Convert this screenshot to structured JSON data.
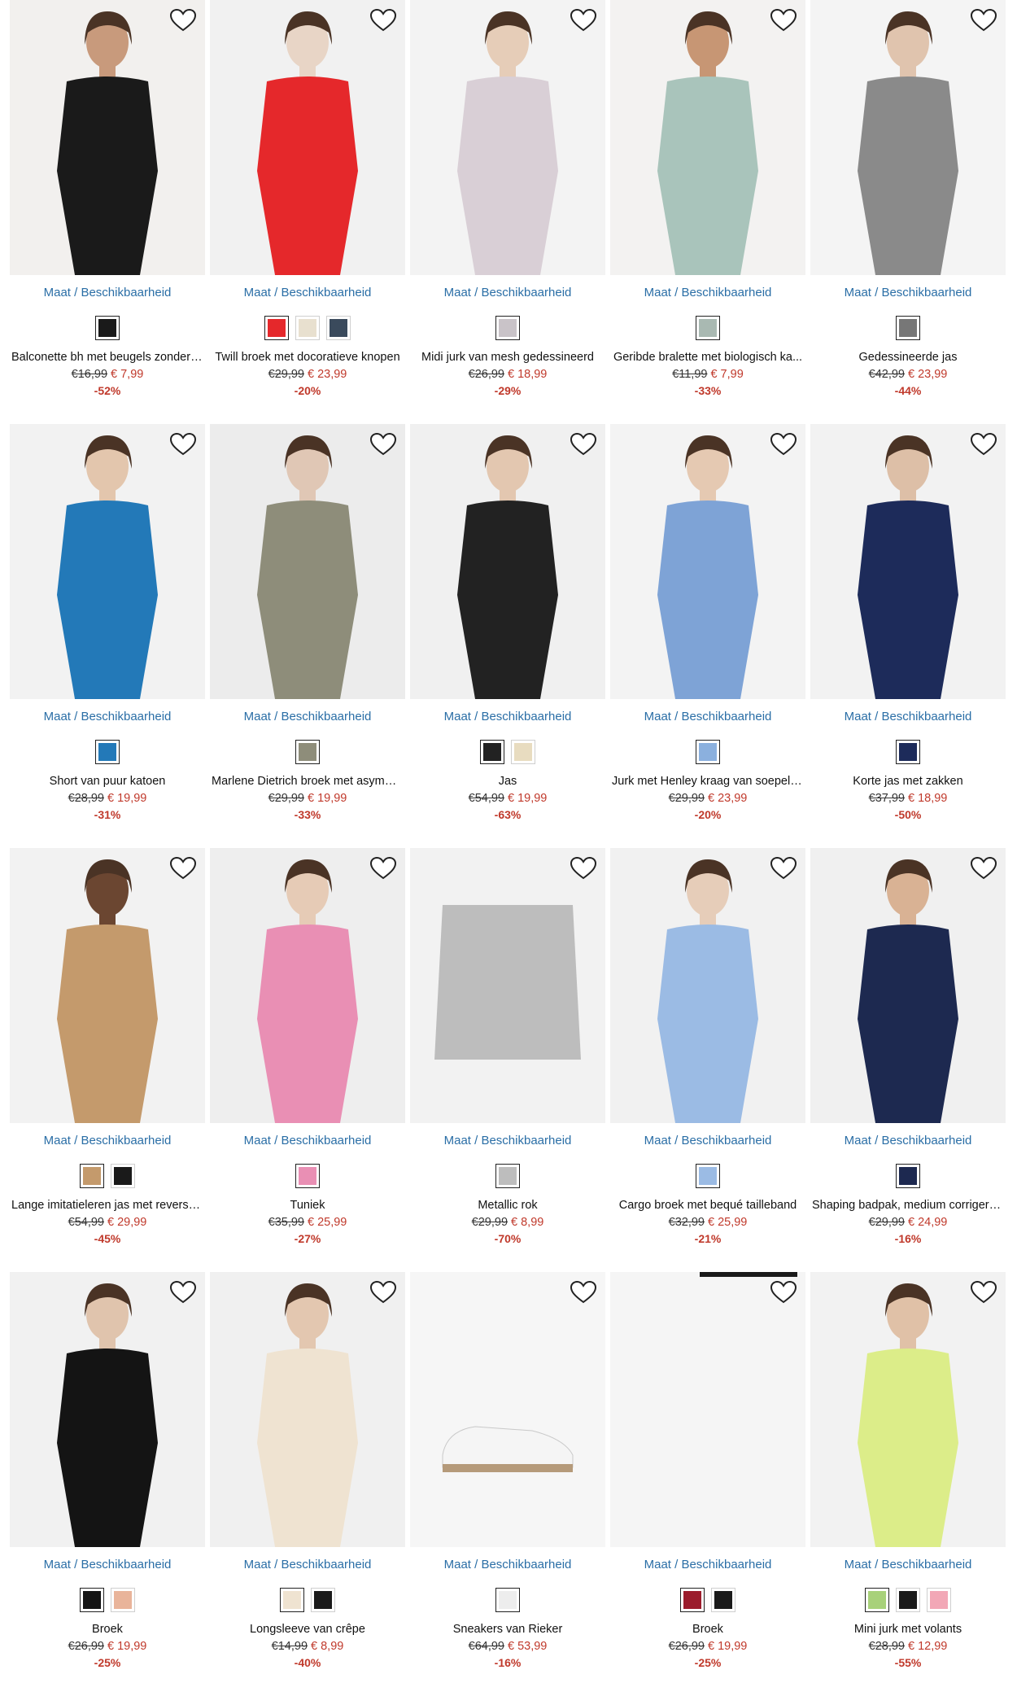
{
  "size_link": "Maat / Beschikbaarheid",
  "products": [
    {
      "title": "Balconette bh met beugels zonder ...",
      "old_price": "€16,99",
      "new_price": "€ 7,99",
      "discount": "-52%",
      "bg": "#f2f0ee",
      "garment": "#1a1a1a",
      "skin": "#c89a7c",
      "swatches": [
        "#1a1a1a"
      ]
    },
    {
      "title": "Twill broek met docoratieve knopen",
      "old_price": "€29,99",
      "new_price": "€ 23,99",
      "discount": "-20%",
      "bg": "#f1f1f1",
      "garment": "#e5282b",
      "skin": "#e8d5c6",
      "swatches": [
        "#e5282b",
        "#e8e0cf",
        "#3a4a5c"
      ]
    },
    {
      "title": "Midi jurk van mesh gedessineerd",
      "old_price": "€26,99",
      "new_price": "€ 18,99",
      "discount": "-29%",
      "bg": "#f3f3f3",
      "garment": "#d9cfd6",
      "skin": "#e6cdb8",
      "swatches": [
        "#c9c3c8"
      ]
    },
    {
      "title": "Geribde bralette met biologisch ka...",
      "old_price": "€11,99",
      "new_price": "€ 7,99",
      "discount": "-33%",
      "bg": "#f3f2f1",
      "garment": "#a9c4bb",
      "skin": "#c79674",
      "swatches": [
        "#a9b9b2"
      ]
    },
    {
      "title": "Gedessineerde jas",
      "old_price": "€42,99",
      "new_price": "€ 23,99",
      "discount": "-44%",
      "bg": "#f4f4f4",
      "garment": "#8a8a8a",
      "skin": "#e0c4ae",
      "swatches": [
        "#777777"
      ]
    },
    {
      "title": "Short van puur katoen",
      "old_price": "€28,99",
      "new_price": "€ 19,99",
      "discount": "-31%",
      "bg": "#f2f2f2",
      "garment": "#2379b8",
      "skin": "#e3c6ad",
      "swatches": [
        "#2379b8"
      ]
    },
    {
      "title": "Marlene Dietrich broek met asymm...",
      "old_price": "€29,99",
      "new_price": "€ 19,99",
      "discount": "-33%",
      "bg": "#ececec",
      "garment": "#8e8d7a",
      "skin": "#e0c7b5",
      "swatches": [
        "#8e8d7a"
      ]
    },
    {
      "title": "Jas",
      "old_price": "€54,99",
      "new_price": "€ 19,99",
      "discount": "-63%",
      "bg": "#f0f0f0",
      "garment": "#222222",
      "skin": "#e3c7b0",
      "swatches": [
        "#222222",
        "#e8dcc0"
      ]
    },
    {
      "title": "Jurk met Henley kraag van soepele ...",
      "old_price": "€29,99",
      "new_price": "€ 23,99",
      "discount": "-20%",
      "bg": "#f3f3f3",
      "garment": "#7ea3d6",
      "skin": "#e5c9b2",
      "swatches": [
        "#8bb0de"
      ]
    },
    {
      "title": "Korte jas met zakken",
      "old_price": "€37,99",
      "new_price": "€ 18,99",
      "discount": "-50%",
      "bg": "#f2f2f2",
      "garment": "#1d2b5a",
      "skin": "#ddbfa7",
      "swatches": [
        "#1d2b5a"
      ]
    },
    {
      "title": "Lange imitatieleren jas met revers, ...",
      "old_price": "€54,99",
      "new_price": "€ 29,99",
      "discount": "-45%",
      "bg": "#f2f2f2",
      "garment": "#c49a6c",
      "skin": "#6b4631",
      "swatches": [
        "#c49a6c",
        "#1a1a1a"
      ]
    },
    {
      "title": "Tuniek",
      "old_price": "€35,99",
      "new_price": "€ 25,99",
      "discount": "-27%",
      "bg": "#eeeeee",
      "garment": "#e98fb4",
      "skin": "#e6cbb6",
      "swatches": [
        "#e98fb4"
      ]
    },
    {
      "title": "Metallic rok",
      "old_price": "€29,99",
      "new_price": "€ 8,99",
      "discount": "-70%",
      "bg": "#f2f2f2",
      "garment": "#bdbdbd",
      "skin": "#f2f2f2",
      "swatches": [
        "#bdbdbd"
      ]
    },
    {
      "title": "Cargo broek met bequé tailleband",
      "old_price": "€32,99",
      "new_price": "€ 25,99",
      "discount": "-21%",
      "bg": "#f1f1f1",
      "garment": "#9bbbe4",
      "skin": "#e6cdb9",
      "swatches": [
        "#9bbbe4"
      ]
    },
    {
      "title": "Shaping badpak, medium corrigerend",
      "old_price": "€29,99",
      "new_price": "€ 24,99",
      "discount": "-16%",
      "bg": "#f0f0f0",
      "garment": "#1d2950",
      "skin": "#d9b294",
      "swatches": [
        "#1d2950"
      ]
    },
    {
      "title": "Broek",
      "old_price": "€26,99",
      "new_price": "€ 19,99",
      "discount": "-25%",
      "bg": "#f1f1f1",
      "garment": "#141414",
      "skin": "#e0c4ad",
      "swatches": [
        "#141414",
        "#e9b49a"
      ]
    },
    {
      "title": "Longsleeve van crêpe",
      "old_price": "€14,99",
      "new_price": "€ 8,99",
      "discount": "-40%",
      "bg": "#f0f0f0",
      "garment": "#efe3d1",
      "skin": "#e3c7b0",
      "swatches": [
        "#efe3d1",
        "#1a1a1a"
      ]
    },
    {
      "title": "Sneakers van Rieker",
      "old_price": "€64,99",
      "new_price": "€ 53,99",
      "discount": "-16%",
      "bg": "#f6f6f6",
      "garment": "#f2f2f2",
      "skin": "#f6f6f6",
      "swatches": [
        "#ededed"
      ]
    },
    {
      "title": "Broek",
      "old_price": "€26,99",
      "new_price": "€ 19,99",
      "discount": "-25%",
      "bg": "#f5f5f5",
      "garment": "#f5f5f5",
      "skin": "#f5f5f5",
      "swatches": [
        "#9b1c2c",
        "#1a1a1a"
      ]
    },
    {
      "title": "Mini jurk met volants",
      "old_price": "€28,99",
      "new_price": "€ 12,99",
      "discount": "-55%",
      "bg": "#f2f2f2",
      "garment": "#dced89",
      "skin": "#e0c1a7",
      "swatches": [
        "#a8d17a",
        "#1a1a1a",
        "#f2a7b6"
      ]
    }
  ]
}
